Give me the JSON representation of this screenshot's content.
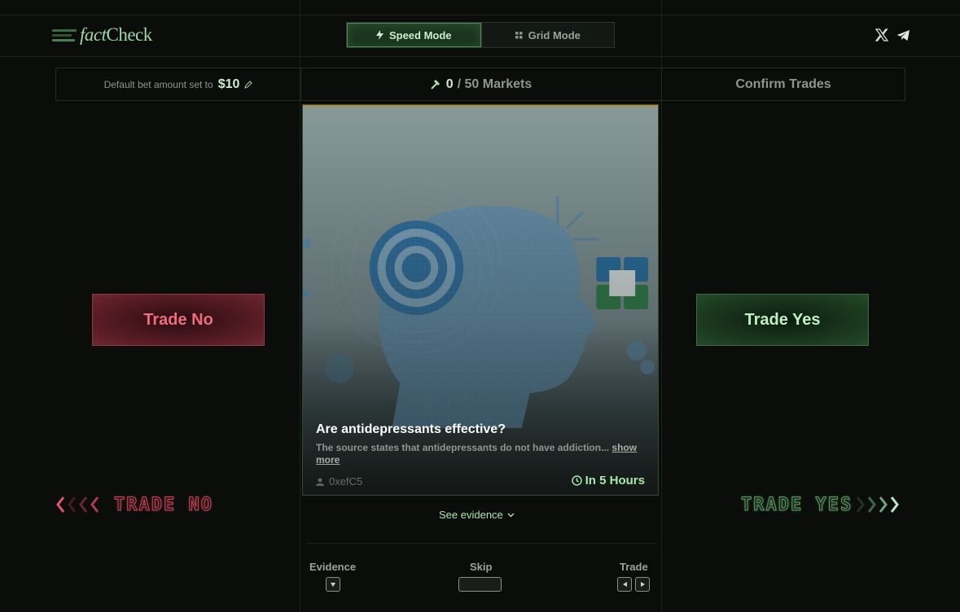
{
  "header": {
    "logo": {
      "part1": "fact",
      "part2": "Check"
    },
    "modes": [
      {
        "label": "Speed Mode",
        "active": true,
        "icon": "bolt-icon"
      },
      {
        "label": "Grid Mode",
        "active": false,
        "icon": "grid-icon"
      }
    ],
    "social": [
      {
        "icon": "x-icon"
      },
      {
        "icon": "telegram-icon"
      }
    ]
  },
  "infobar": {
    "bet_label": "Default bet amount set to",
    "bet_value": "$10",
    "markets_count": "0",
    "markets_total": "/ 50 Markets",
    "confirm_label": "Confirm Trades"
  },
  "trade_no_label": "Trade No",
  "trade_yes_label": "Trade Yes",
  "card": {
    "title": "Are antidepressants effective?",
    "description": "The source states that antidepressants do not have addiction...",
    "show_more": "show more",
    "author": "0xefC5",
    "time": "In 5 Hours"
  },
  "see_evidence": "See evidence",
  "swipe_no_label": "TRADE NO",
  "swipe_yes_label": "TRADE YES",
  "hints": {
    "evidence": "Evidence",
    "skip": "Skip",
    "trade": "Trade"
  },
  "colors": {
    "background": "#0a0d0a",
    "accent_green": "#a8e6ae",
    "accent_red": "#f06b7c"
  }
}
